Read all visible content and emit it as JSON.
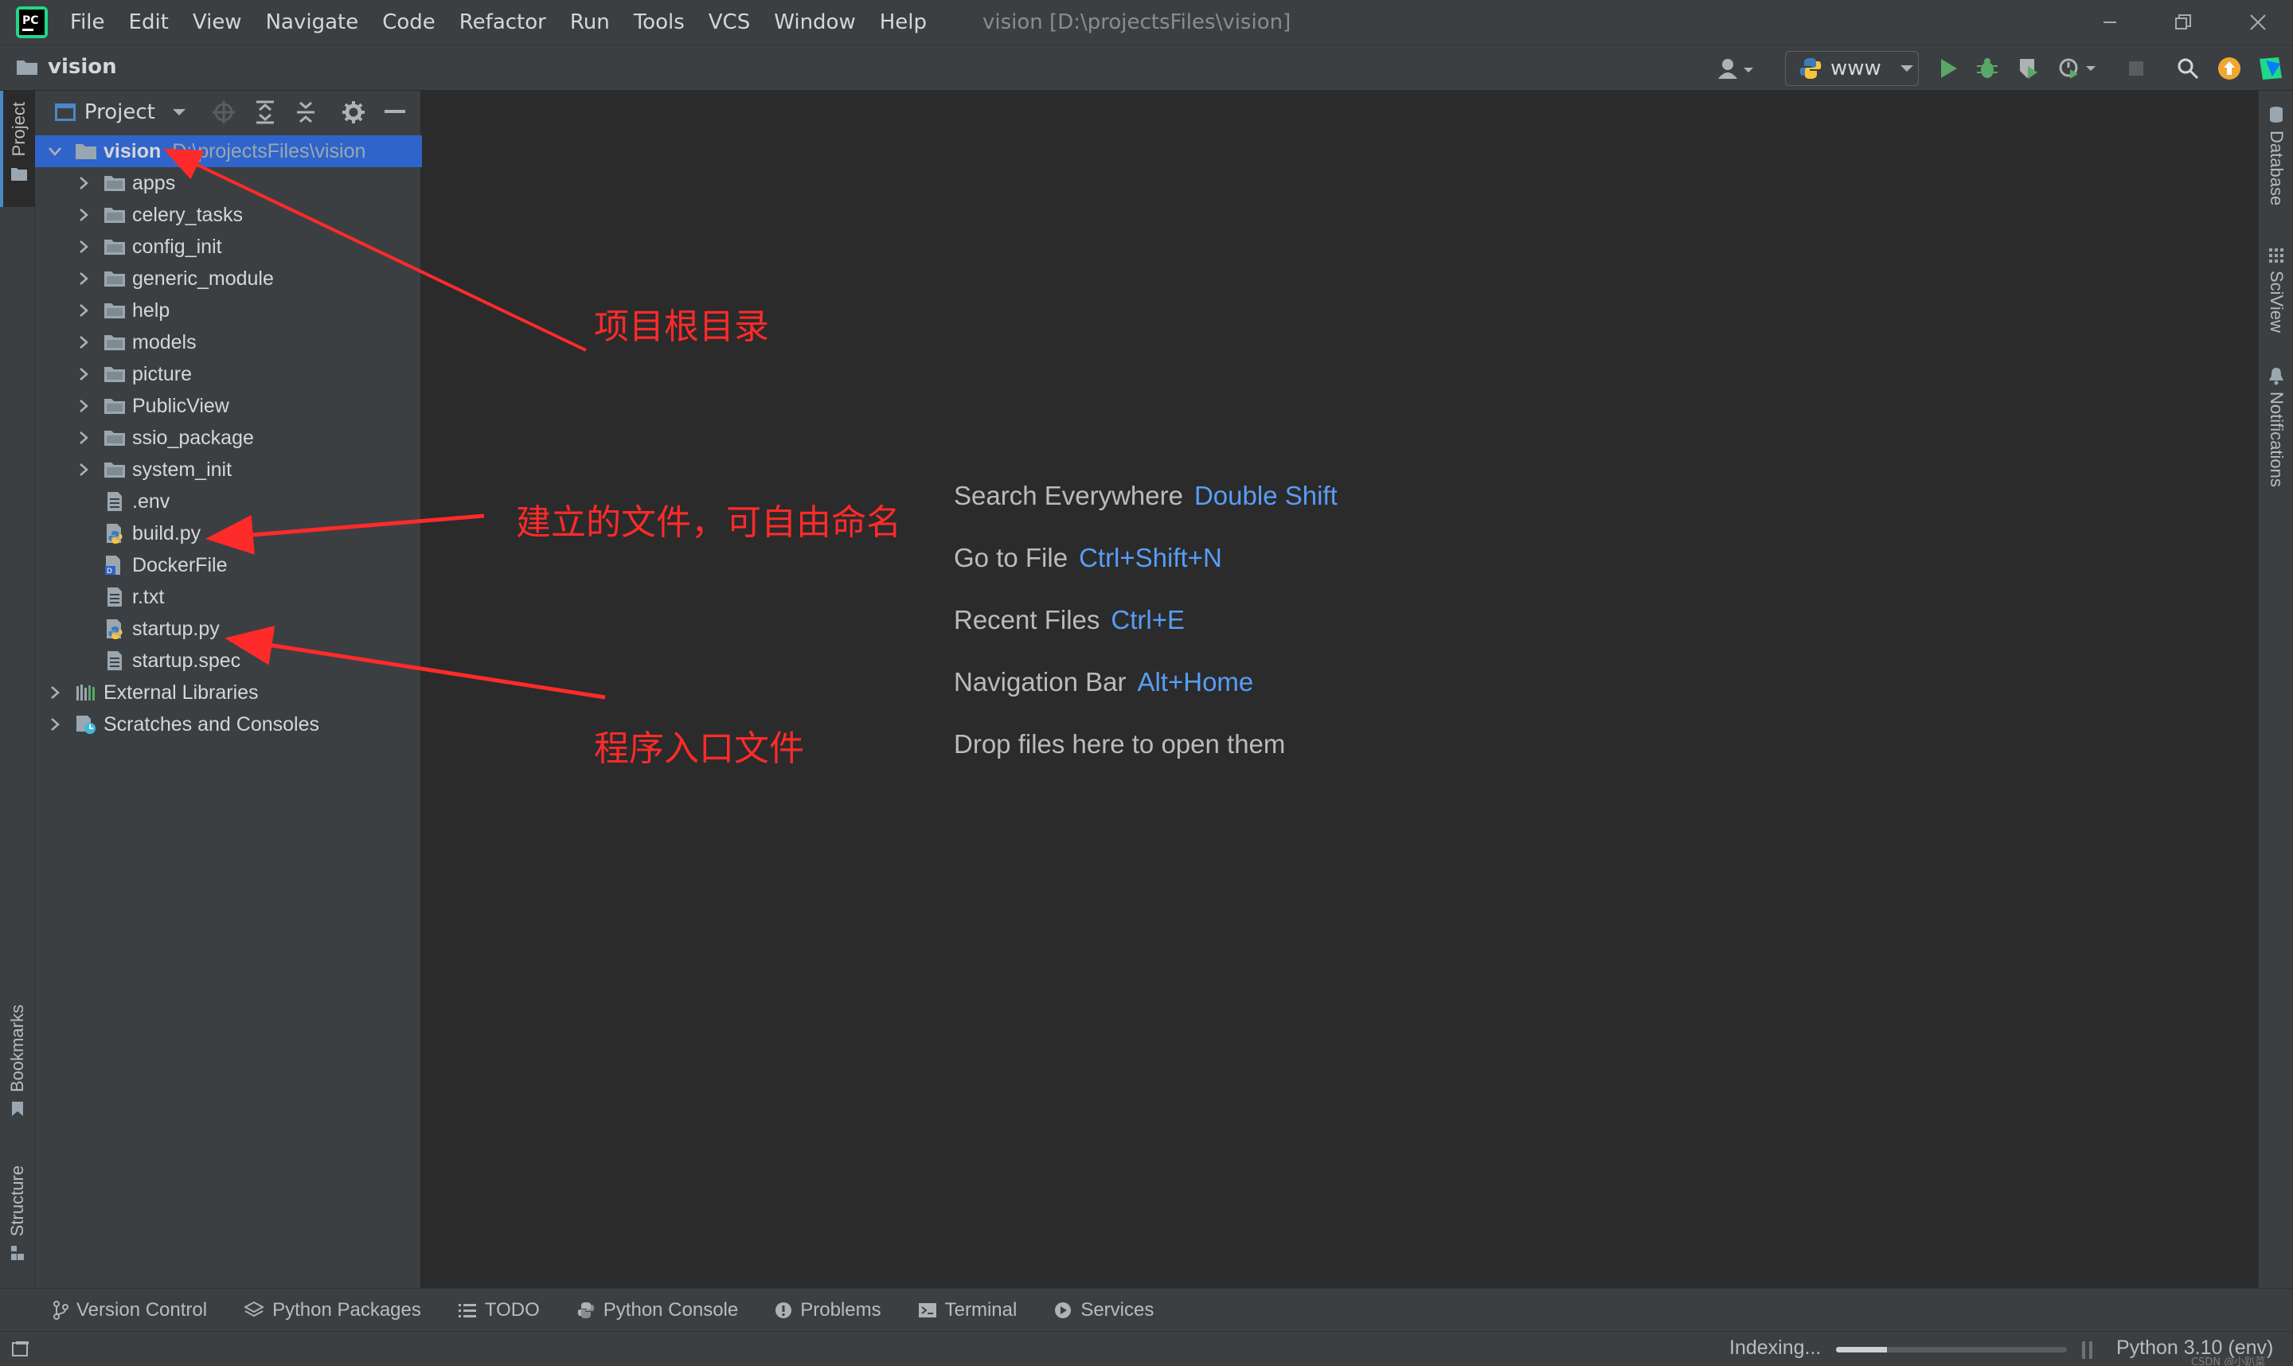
{
  "menubar": {
    "items": [
      "File",
      "Edit",
      "View",
      "Navigate",
      "Code",
      "Refactor",
      "Run",
      "Tools",
      "VCS",
      "Window",
      "Help"
    ],
    "window_title": "vision [D:\\projectsFiles\\vision]"
  },
  "navbar": {
    "breadcrumb": "vision",
    "run_config": "www"
  },
  "left_stripe": {
    "project_tab": "Project",
    "bookmarks_tab": "Bookmarks",
    "structure_tab": "Structure"
  },
  "right_stripe": {
    "database_tab": "Database",
    "sciview_tab": "SciView",
    "notifications_tab": "Notifications"
  },
  "project_panel": {
    "title": "Project",
    "tree": [
      {
        "label": "vision",
        "path": "D:\\projectsFiles\\vision",
        "kind": "root-folder"
      },
      {
        "label": "apps",
        "kind": "folder"
      },
      {
        "label": "celery_tasks",
        "kind": "folder"
      },
      {
        "label": "config_init",
        "kind": "folder"
      },
      {
        "label": "generic_module",
        "kind": "folder"
      },
      {
        "label": "help",
        "kind": "folder"
      },
      {
        "label": "models",
        "kind": "folder"
      },
      {
        "label": "picture",
        "kind": "folder"
      },
      {
        "label": "PublicView",
        "kind": "folder"
      },
      {
        "label": "ssio_package",
        "kind": "folder"
      },
      {
        "label": "system_init",
        "kind": "folder"
      },
      {
        "label": ".env",
        "kind": "text-file"
      },
      {
        "label": "build.py",
        "kind": "python-file"
      },
      {
        "label": "DockerFile",
        "kind": "docker-file"
      },
      {
        "label": "r.txt",
        "kind": "text-file"
      },
      {
        "label": "startup.py",
        "kind": "python-file"
      },
      {
        "label": "startup.spec",
        "kind": "text-file"
      },
      {
        "label": "External Libraries",
        "kind": "libraries"
      },
      {
        "label": "Scratches and Consoles",
        "kind": "scratches"
      }
    ]
  },
  "editor": {
    "hints": [
      {
        "label": "Search Everywhere",
        "shortcut": "Double Shift"
      },
      {
        "label": "Go to File",
        "shortcut": "Ctrl+Shift+N"
      },
      {
        "label": "Recent Files",
        "shortcut": "Ctrl+E"
      },
      {
        "label": "Navigation Bar",
        "shortcut": "Alt+Home"
      },
      {
        "label": "Drop files here to open them",
        "shortcut": ""
      }
    ]
  },
  "annotations": {
    "root": "项目根目录",
    "created_file": "建立的文件，可自由命名",
    "entry_file": "程序入口文件",
    "color": "#ff2a2a"
  },
  "bottom_tabs": [
    "Version Control",
    "Python Packages",
    "TODO",
    "Python Console",
    "Problems",
    "Terminal",
    "Services"
  ],
  "statusbar": {
    "indexing": "Indexing...",
    "progress": 0.22,
    "interpreter": "Python 3.10 (env)",
    "watermark": "CSDN @小趴菜"
  },
  "colors": {
    "selection": "#2f65ca",
    "shortcut": "#589df6",
    "run_green": "#59a869"
  }
}
